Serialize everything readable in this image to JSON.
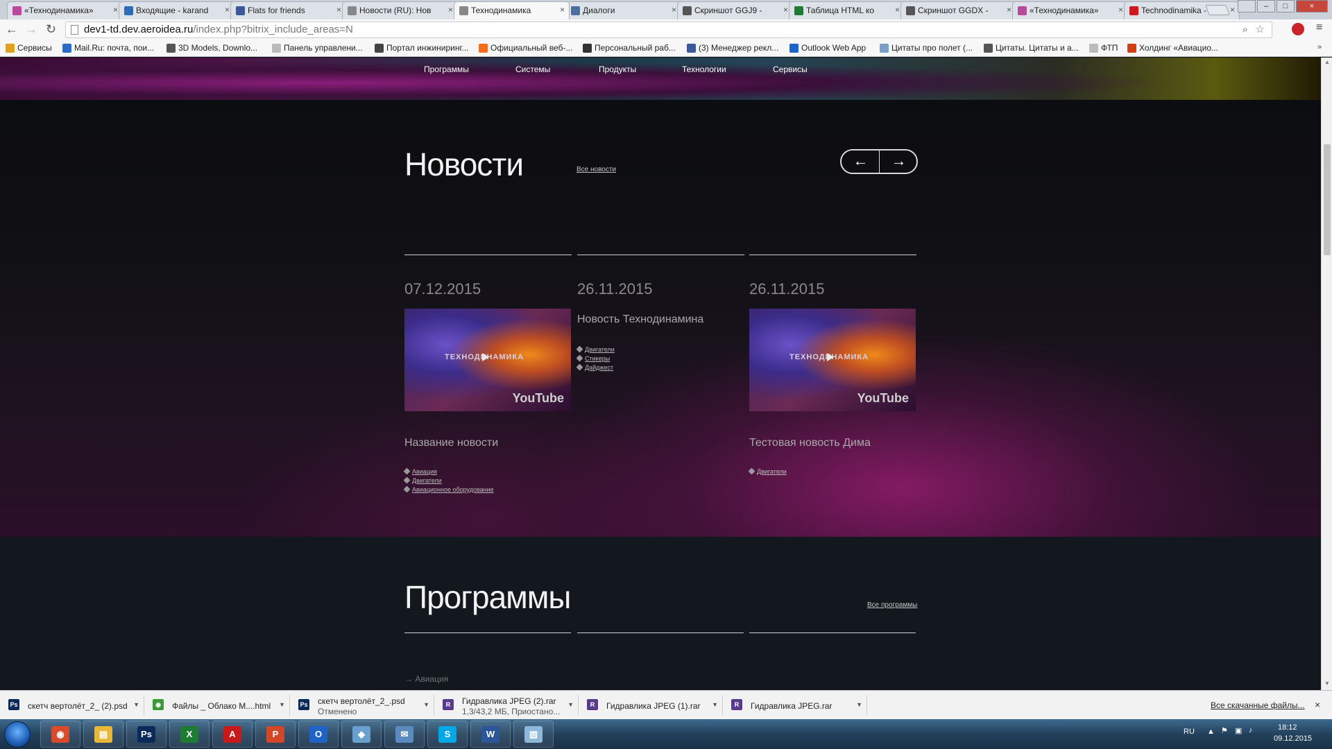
{
  "tabs": [
    {
      "label": "«Технодинамика»",
      "icon_color": "#b9499b"
    },
    {
      "label": "Входящие - karand",
      "icon_color": "#2a6ebb"
    },
    {
      "label": "Flats for friends",
      "icon_color": "#3b5998"
    },
    {
      "label": "Новости (RU): Нов",
      "icon_color": "#888888"
    },
    {
      "label": "Технодинамика",
      "icon_color": "#888888"
    },
    {
      "label": "Диалоги",
      "icon_color": "#4b6f9c"
    },
    {
      "label": "Скриншот GGJ9 -",
      "icon_color": "#555555"
    },
    {
      "label": "Таблица HTML ко",
      "icon_color": "#1e7b34"
    },
    {
      "label": "Скриншот GGDX -",
      "icon_color": "#555555"
    },
    {
      "label": "«Технодинамика»",
      "icon_color": "#b9499b"
    },
    {
      "label": "Technodinamika -",
      "icon_color": "#cc181e"
    }
  ],
  "address": {
    "host": "dev1-td.dev.aeroidea.ru",
    "path": "/index.php?bitrix_include_areas=N"
  },
  "bookmarks": [
    {
      "label": "Сервисы",
      "icon_color": "#e0a020"
    },
    {
      "label": "Mail.Ru: почта, пои...",
      "icon_color": "#2b6cc4"
    },
    {
      "label": "3D Models, Downlo...",
      "icon_color": "#555555"
    },
    {
      "label": "Панель управлени...",
      "icon_color": "#bbbbbb"
    },
    {
      "label": "Портал инжиниринг...",
      "icon_color": "#444444"
    },
    {
      "label": "Официальный веб-...",
      "icon_color": "#f07020"
    },
    {
      "label": "Персональный раб...",
      "icon_color": "#333333"
    },
    {
      "label": "(3) Менеджер рекл...",
      "icon_color": "#3b5998"
    },
    {
      "label": "Outlook Web App",
      "icon_color": "#1e64c8"
    },
    {
      "label": "Цитаты про полет (...",
      "icon_color": "#7aa0c8"
    },
    {
      "label": "Цитаты. Цитаты и а...",
      "icon_color": "#555555"
    },
    {
      "label": "ФТП",
      "icon_color": "#bbbbbb"
    },
    {
      "label": "Холдинг «Авиацио...",
      "icon_color": "#d04010"
    }
  ],
  "main_nav": [
    "Программы",
    "Системы",
    "Продукты",
    "Технологии",
    "Сервисы"
  ],
  "news": {
    "title": "Новости",
    "all_link": "Все новости",
    "prev_arrow": "←",
    "next_arrow": "→",
    "items": [
      {
        "date": "07.12.2015",
        "has_video": true,
        "video_text": "ТЕХНОДИНАМИКА",
        "video_brand": "YouTube",
        "title": "Название новости",
        "tags": [
          "Авиация",
          "Двигатели",
          "Авиационное оборудование"
        ]
      },
      {
        "date": "26.11.2015",
        "has_video": false,
        "title": "Новость Технодинамина",
        "tags": [
          "Двигатели",
          "Стикеры",
          "Дайджест"
        ]
      },
      {
        "date": "26.11.2015",
        "has_video": true,
        "video_text": "ТЕХНОДИНАМИКА",
        "video_brand": "YouTube",
        "title": "Тестовая новость Дима",
        "tags": [
          "Двигатели"
        ]
      }
    ]
  },
  "programs": {
    "title": "Программы",
    "all_link": "Все программы",
    "first_item": "→ Авиация"
  },
  "downloads": {
    "items": [
      {
        "name": "скетч вертолёт_2_ (2).psd",
        "sub": "",
        "icon": "Ps",
        "icon_color": "#0a2a5a"
      },
      {
        "name": "Файлы _ Облако M....html",
        "sub": "",
        "icon": "◉",
        "icon_color": "#3a9a3a"
      },
      {
        "name": "скетч вертолёт_2_.psd",
        "sub": "Отменено",
        "icon": "Ps",
        "icon_color": "#0a2a5a"
      },
      {
        "name": "Гидравлика JPEG (2).rar",
        "sub": "1,3/43,2 МБ, Приостано...",
        "icon": "R",
        "icon_color": "#5a3a8a"
      },
      {
        "name": "Гидравлика JPEG (1).rar",
        "sub": "",
        "icon": "R",
        "icon_color": "#5a3a8a"
      },
      {
        "name": "Гидравлика JPEG.rar",
        "sub": "",
        "icon": "R",
        "icon_color": "#5a3a8a"
      }
    ],
    "all_link": "Все скачанные файлы...",
    "close": "×"
  },
  "taskbar": {
    "apps": [
      {
        "name": "chrome",
        "label": "◉",
        "color": "#d84a2a"
      },
      {
        "name": "explorer",
        "label": "▤",
        "color": "#e8b73a"
      },
      {
        "name": "photoshop",
        "label": "Ps",
        "color": "#0a2a5a"
      },
      {
        "name": "excel",
        "label": "X",
        "color": "#1e7b34"
      },
      {
        "name": "acrobat",
        "label": "A",
        "color": "#c81a1a"
      },
      {
        "name": "powerpoint",
        "label": "P",
        "color": "#d24726"
      },
      {
        "name": "outlook",
        "label": "O",
        "color": "#1e64c8"
      },
      {
        "name": "app-blue",
        "label": "◆",
        "color": "#6aa0d0"
      },
      {
        "name": "app-mail",
        "label": "✉",
        "color": "#5a8ac0"
      },
      {
        "name": "skype",
        "label": "S",
        "color": "#00a8e8"
      },
      {
        "name": "word",
        "label": "W",
        "color": "#2b579a"
      },
      {
        "name": "paint",
        "label": "▧",
        "color": "#8fb8d8"
      }
    ],
    "lang": "RU",
    "time": "18:12",
    "date": "09.12.2015"
  }
}
